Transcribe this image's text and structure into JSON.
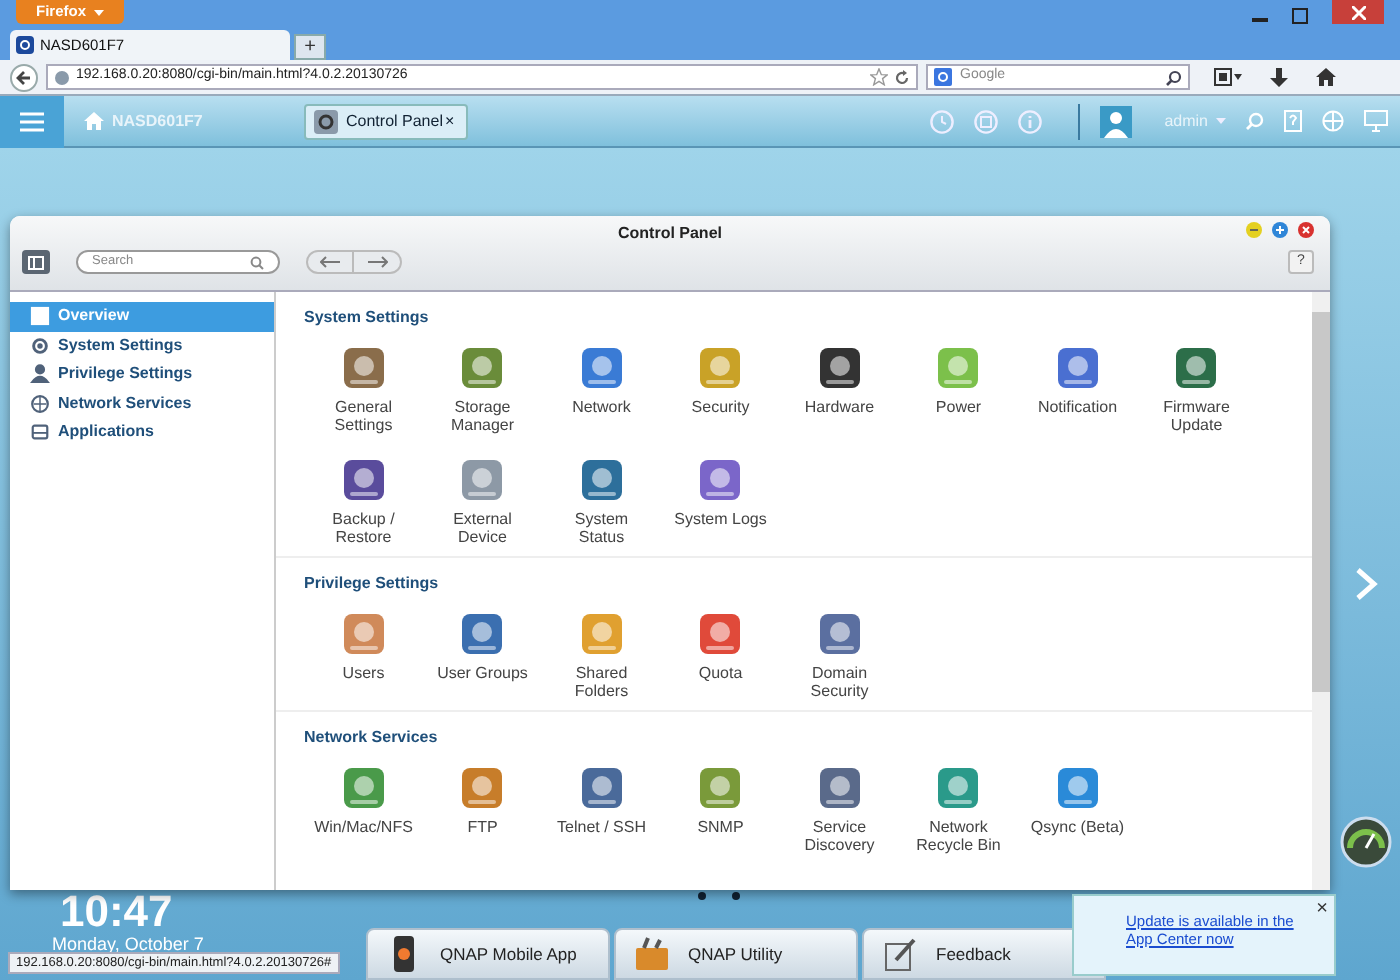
{
  "browser": {
    "menu_button": "Firefox",
    "tab": "NASD601F7",
    "new_tab": "+",
    "url": "192.168.0.20:8080/cgi-bin/main.html?4.0.2.20130726",
    "search_placeholder": "Google",
    "status_url": "192.168.0.20:8080/cgi-bin/main.html?4.0.2.20130726#"
  },
  "top_bar": {
    "hostname": "NASD601F7",
    "app_tab": "Control Panel",
    "app_tab_close": "×",
    "user": "admin"
  },
  "window": {
    "title": "Control Panel",
    "search_placeholder": "Search",
    "help": "?"
  },
  "sidebar": {
    "items": [
      {
        "label": "Overview",
        "selected": true
      },
      {
        "label": "System Settings",
        "selected": false
      },
      {
        "label": "Privilege Settings",
        "selected": false
      },
      {
        "label": "Network Services",
        "selected": false
      },
      {
        "label": "Applications",
        "selected": false
      }
    ]
  },
  "sections": [
    {
      "title": "System Settings",
      "items": [
        "General Settings",
        "Storage Manager",
        "Network",
        "Security",
        "Hardware",
        "Power",
        "Notification",
        "Firmware Update",
        "Backup / Restore",
        "External Device",
        "System Status",
        "System Logs"
      ]
    },
    {
      "title": "Privilege Settings",
      "items": [
        "Users",
        "User Groups",
        "Shared Folders",
        "Quota",
        "Domain Security"
      ]
    },
    {
      "title": "Network Services",
      "items": [
        "Win/Mac/NFS",
        "FTP",
        "Telnet / SSH",
        "SNMP",
        "Service Discovery",
        "Network Recycle Bin",
        "Qsync (Beta)"
      ]
    }
  ],
  "desktop": {
    "clock": "10:47",
    "date": "Monday, October 7",
    "dock": [
      "QNAP Mobile App",
      "QNAP Utility",
      "Feedback"
    ],
    "notification": "Update is available in the App Center now",
    "notification_close": "×"
  }
}
